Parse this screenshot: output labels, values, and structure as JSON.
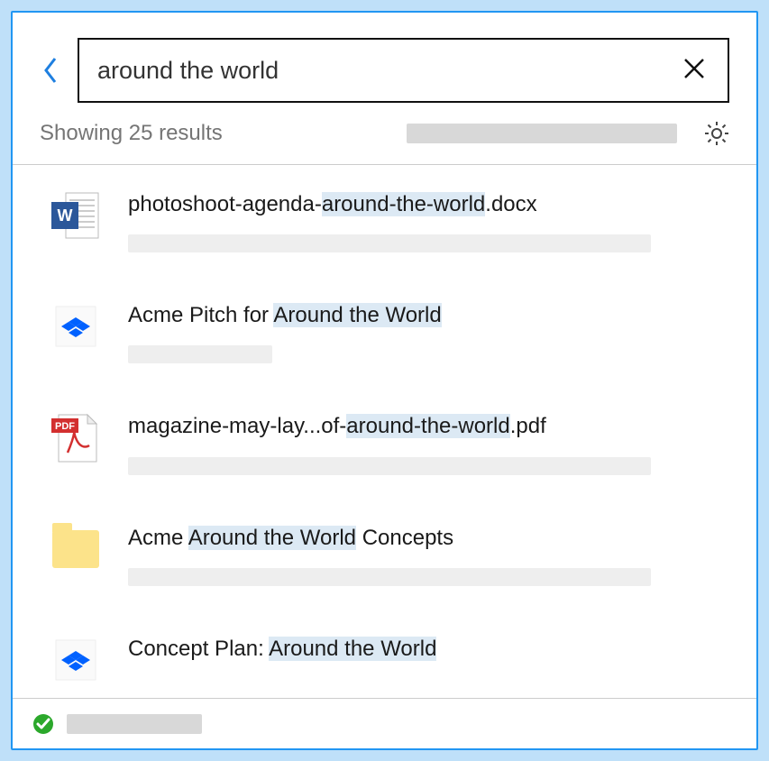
{
  "search": {
    "value": "around the world",
    "placeholder": ""
  },
  "status": {
    "text": "Showing 25 results"
  },
  "highlight_color": "#dce9f4",
  "results": [
    {
      "icon": "word",
      "title_parts": [
        {
          "t": "photoshoot-agenda-",
          "hl": false
        },
        {
          "t": "around-the-world",
          "hl": true
        },
        {
          "t": ".docx",
          "hl": false
        }
      ],
      "placeholder": "wide"
    },
    {
      "icon": "dropbox",
      "title_parts": [
        {
          "t": "Acme Pitch for ",
          "hl": false
        },
        {
          "t": "Around the World",
          "hl": true
        }
      ],
      "placeholder": "small"
    },
    {
      "icon": "pdf",
      "title_parts": [
        {
          "t": "magazine-may-lay...of-",
          "hl": false
        },
        {
          "t": "around-the-world",
          "hl": true
        },
        {
          "t": ".pdf",
          "hl": false
        }
      ],
      "placeholder": "wide"
    },
    {
      "icon": "folder",
      "title_parts": [
        {
          "t": "Acme ",
          "hl": false
        },
        {
          "t": "Around the World",
          "hl": true
        },
        {
          "t": " Concepts",
          "hl": false
        }
      ],
      "placeholder": "wide"
    },
    {
      "icon": "dropbox",
      "title_parts": [
        {
          "t": "Concept Plan: ",
          "hl": false
        },
        {
          "t": "Around the World",
          "hl": true
        }
      ],
      "placeholder": "none"
    }
  ]
}
